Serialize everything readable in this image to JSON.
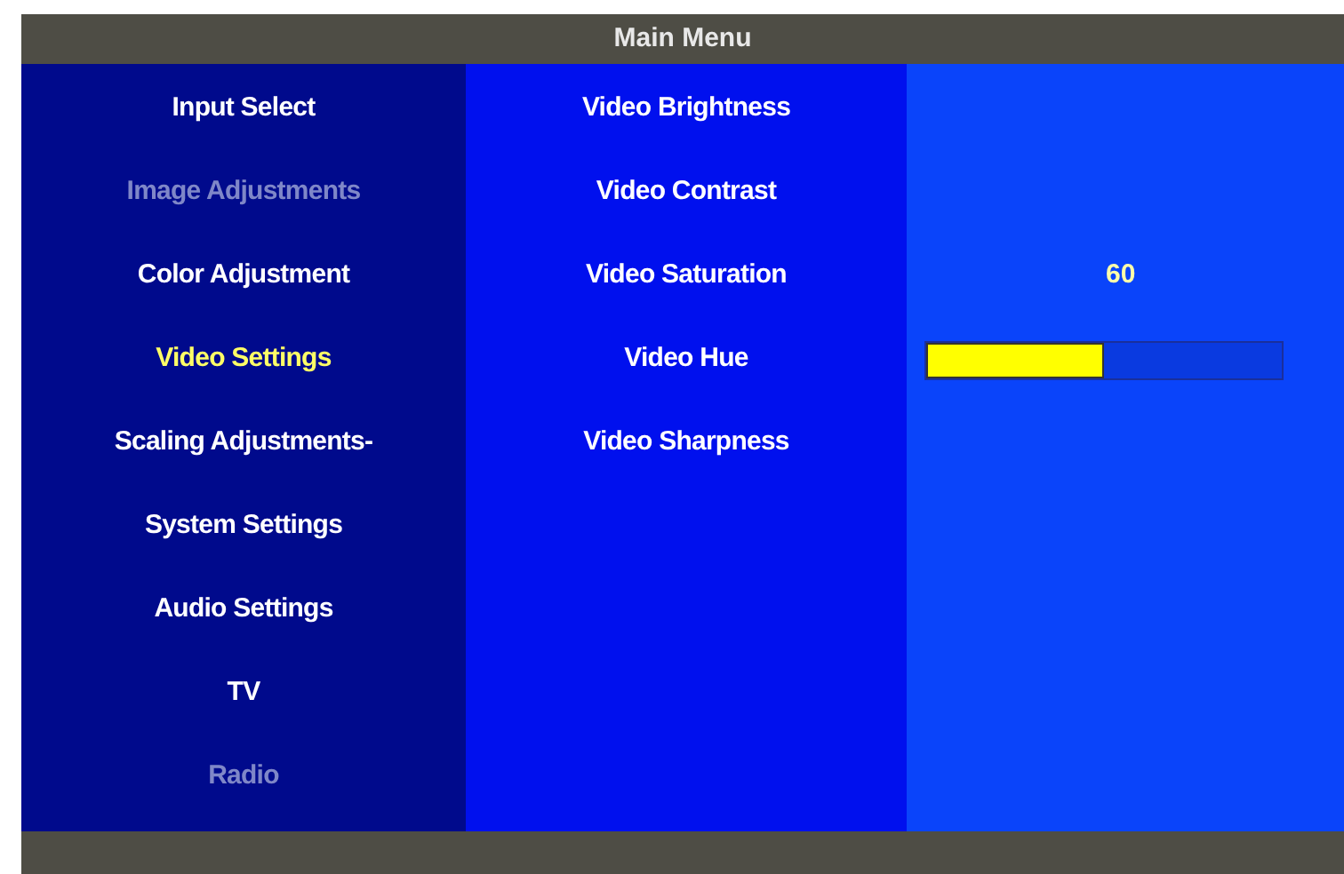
{
  "window": {
    "title": "Main Menu"
  },
  "menu": [
    {
      "label": "Input Select",
      "selected": false,
      "disabled": false
    },
    {
      "label": "Image Adjustments",
      "selected": false,
      "disabled": true
    },
    {
      "label": "Color Adjustment",
      "selected": false,
      "disabled": false
    },
    {
      "label": "Video Settings",
      "selected": true,
      "disabled": false
    },
    {
      "label": "Scaling Adjustments-",
      "selected": false,
      "disabled": false
    },
    {
      "label": "System Settings",
      "selected": false,
      "disabled": false
    },
    {
      "label": "Audio Settings",
      "selected": false,
      "disabled": false
    },
    {
      "label": "TV",
      "selected": false,
      "disabled": false
    },
    {
      "label": "Radio",
      "selected": false,
      "disabled": true
    }
  ],
  "submenu": [
    {
      "label": "Video Brightness"
    },
    {
      "label": "Video Contrast"
    },
    {
      "label": "Video Saturation"
    },
    {
      "label": "Video Hue"
    },
    {
      "label": "Video Sharpness"
    }
  ],
  "adjustment": {
    "reading": "60",
    "level": 0.5
  }
}
